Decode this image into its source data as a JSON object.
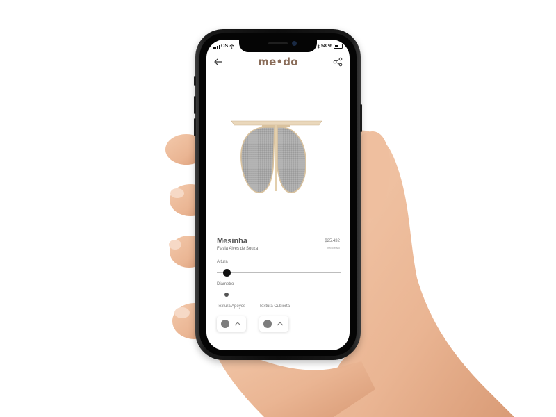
{
  "status_bar": {
    "carrier": "OS",
    "battery": "58 %"
  },
  "app": {
    "logo_left": "me",
    "logo_dot": "•",
    "logo_right": "do"
  },
  "product": {
    "name": "Mesinha",
    "author": "Flavia Alves de Souza",
    "price": "$25.432",
    "price_note": "precio envio"
  },
  "controls": {
    "altura_label": "Altura",
    "altura_value": 0.08,
    "diametro_label": "Diametro",
    "diametro_value": 0.08,
    "textura_apoyos_label": "Textura Apoyos",
    "textura_cubierta_label": "Textura Cubierta"
  },
  "colors": {
    "brand": "#8a6d5a",
    "swatch": "#7d7d7d"
  },
  "icons": [
    "back-arrow-icon",
    "share-icon",
    "chevron-up-icon"
  ]
}
